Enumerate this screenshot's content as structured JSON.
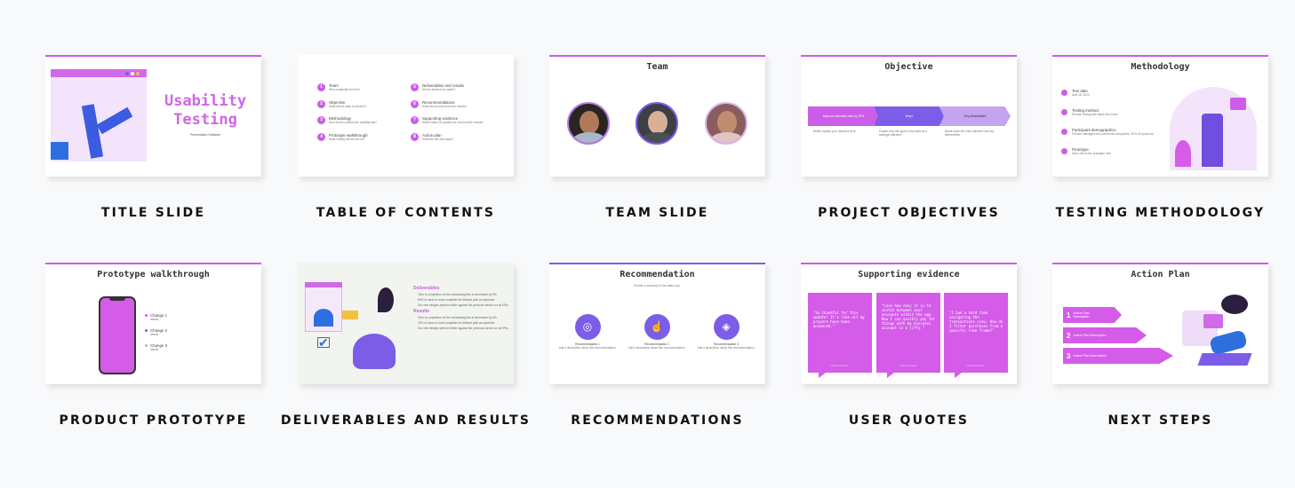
{
  "colors": {
    "accent": "#cc5de8",
    "accent_purple": "#7b5de8",
    "background": "#f8f9fb"
  },
  "templates": [
    {
      "caption": "TITLE SLIDE",
      "slide": {
        "title_line1": "Usability",
        "title_line2": "Testing",
        "subtitle": "Presentation Software"
      }
    },
    {
      "caption": "TABLE OF CONTENTS",
      "slide": {
        "items": [
          {
            "num": "1",
            "title": "Team",
            "desc": "Who conducted the test?"
          },
          {
            "num": "2",
            "title": "Objective",
            "desc": "What did we want to achieve?"
          },
          {
            "num": "3",
            "title": "Methodology",
            "desc": "How did we conduct the usability test?"
          },
          {
            "num": "4",
            "title": "Prototype walkthrough",
            "desc": "What exactly did we test on?"
          },
          {
            "num": "5",
            "title": "Deliverables and results",
            "desc": "Did we achieve our goals?"
          },
          {
            "num": "6",
            "title": "Recommendations",
            "desc": "What did we learn from the results?"
          },
          {
            "num": "7",
            "title": "Supporting evidence",
            "desc": "What makes us positive we can trust the results?"
          },
          {
            "num": "8",
            "title": "Action plan",
            "desc": "What are the next steps?"
          }
        ]
      }
    },
    {
      "caption": "TEAM SLIDE",
      "slide": {
        "title": "Team",
        "members": [
          "team-member-1",
          "team-member-2",
          "team-member-3"
        ]
      }
    },
    {
      "caption": "PROJECT OBJECTIVES",
      "slide": {
        "title": "Objective",
        "steps": [
          {
            "label": "Improve activation rate by 10%",
            "desc": "Briefly explain your objective here."
          },
          {
            "label": "Why?",
            "desc": "Explain why this goal is important as a strategic objective."
          },
          {
            "label": "Key deliverables",
            "desc": "Break down the main objective into key deliverables."
          }
        ]
      }
    },
    {
      "caption": "TESTING METHODOLOGY",
      "slide": {
        "title": "Methodology",
        "items": [
          {
            "title": "Test date",
            "desc": "April 18, 2022"
          },
          {
            "title": "Testing method",
            "desc": "Remote testing with Maze and Zoom"
          },
          {
            "title": "Participant demographics",
            "desc": "Product managers at e-commerce companies, 25 to 40 years old"
          },
          {
            "title": "Prototype",
            "desc": "Add a link to the prototype here"
          }
        ]
      }
    },
    {
      "caption": "PRODUCT PROTOTYPE",
      "slide": {
        "title": "Prototype walkthrough",
        "changes": [
          {
            "label": "Change 1",
            "desc": "details"
          },
          {
            "label": "Change 2",
            "desc": "details"
          },
          {
            "label": "Change 3",
            "desc": "details"
          }
        ]
      }
    },
    {
      "caption": "DELIVERABLES AND RESULTS",
      "slide": {
        "deliverables_heading": "Deliverables",
        "deliverables": [
          "Time to completion on the onboarding flow is decreased by 5%.",
          "60% of users or more complete the defined path as expected.",
          "Our new designs perform better against the previous version on all KPIs."
        ],
        "results_heading": "Results",
        "results": [
          "Time to completion on the onboarding flow is decreased by 5%.",
          "42% of users or more complete the defined path as expected.",
          "Our new designs perform better against the previous version on all KPIs."
        ]
      }
    },
    {
      "caption": "RECOMMENDATIONS",
      "slide": {
        "title": "Recommendation",
        "subtitle": "Provide a summary of the status quo.",
        "items": [
          {
            "icon": "target-icon",
            "glyph": "◎",
            "label": "Recommendation 1",
            "desc": "Add a description about this recommendation."
          },
          {
            "icon": "touch-icon",
            "glyph": "☝",
            "label": "Recommendation 2",
            "desc": "Add a description about this recommendation."
          },
          {
            "icon": "layers-icon",
            "glyph": "◈",
            "label": "Recommendation 3",
            "desc": "Add a description about this recommendation."
          }
        ]
      }
    },
    {
      "caption": "USER QUOTES",
      "slide": {
        "title": "Supporting evidence",
        "quotes": [
          {
            "text": "\"So thankful for this update! It's like all my prayers have been answered.\"",
            "name": "Name Surname"
          },
          {
            "text": "\"Love how easy it is to switch between your accounts within the app. Now I can quickly pay for things with my business account in a jiffy.\"",
            "name": "Name Surname"
          },
          {
            "text": "\"I had a hard time navigating the transactions view. How do I filter purchases from a specific time frame?\"",
            "name": "Name Surname"
          }
        ]
      }
    },
    {
      "caption": "NEXT STEPS",
      "slide": {
        "title": "Action Plan",
        "steps": [
          {
            "num": "1",
            "label": "Action Plan Description"
          },
          {
            "num": "2",
            "label": "Action Plan Description"
          },
          {
            "num": "3",
            "label": "Action Plan Description"
          }
        ]
      }
    }
  ]
}
